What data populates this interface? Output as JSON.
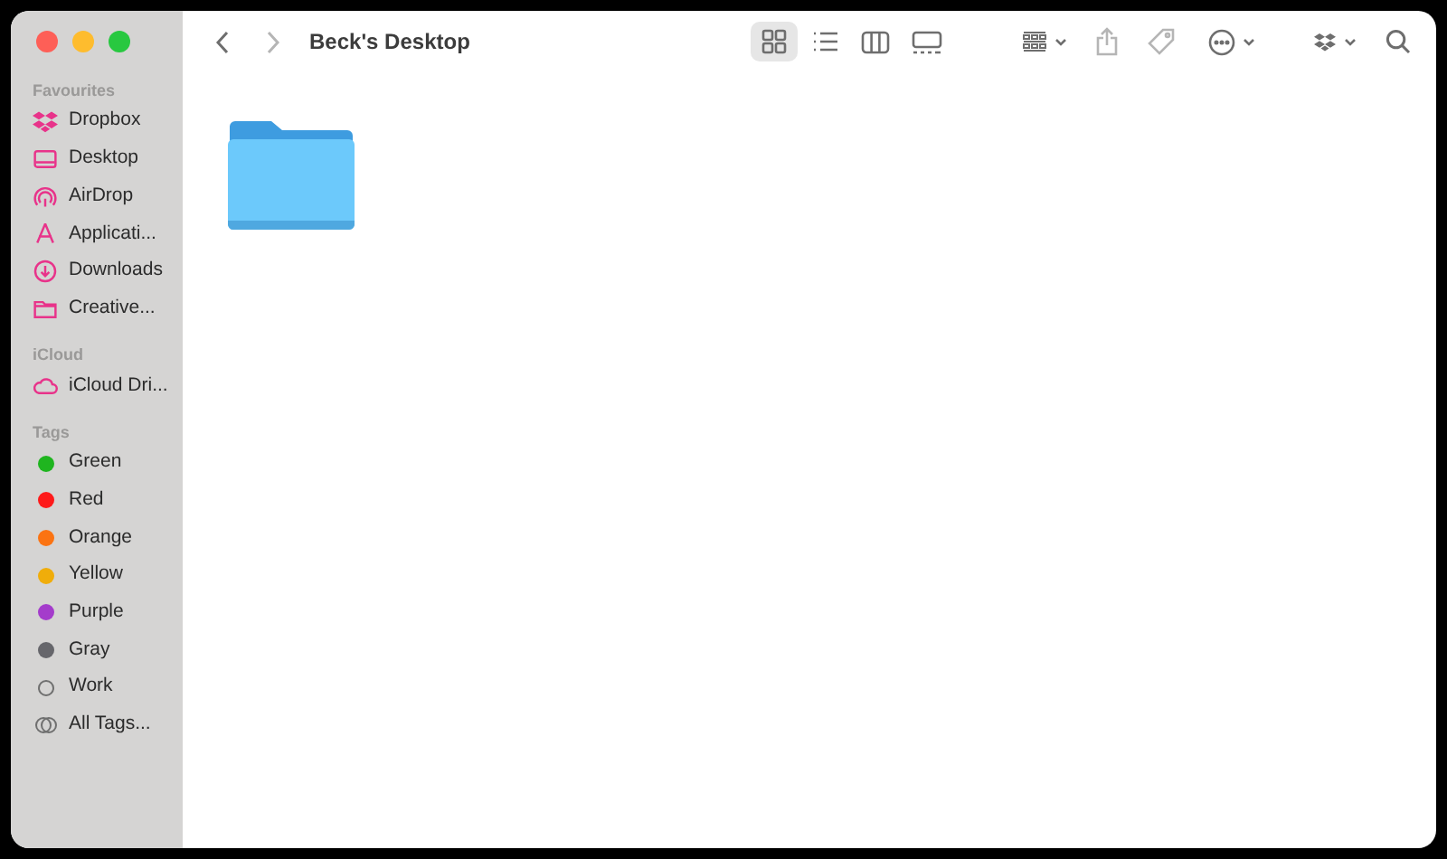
{
  "window": {
    "title": "Beck's Desktop"
  },
  "sidebar": {
    "sections": [
      {
        "heading": "Favourites",
        "items": [
          {
            "label": "Dropbox",
            "kind": "dropbox"
          },
          {
            "label": "Desktop",
            "kind": "desktop"
          },
          {
            "label": "AirDrop",
            "kind": "airdrop"
          },
          {
            "label": "Applicati...",
            "kind": "apps"
          },
          {
            "label": "Downloads",
            "kind": "downloads"
          },
          {
            "label": "Creative...",
            "kind": "folder"
          }
        ]
      },
      {
        "heading": "iCloud",
        "items": [
          {
            "label": "iCloud Dri...",
            "kind": "cloud"
          }
        ]
      },
      {
        "heading": "Tags",
        "items": [
          {
            "label": "Green",
            "kind": "dot",
            "color": "#1fb51f"
          },
          {
            "label": "Red",
            "kind": "dot",
            "color": "#fe1a1a"
          },
          {
            "label": "Orange",
            "kind": "dot",
            "color": "#fb7312"
          },
          {
            "label": "Yellow",
            "kind": "dot",
            "color": "#f0ad0a"
          },
          {
            "label": "Purple",
            "kind": "dot",
            "color": "#a43ccb"
          },
          {
            "label": "Gray",
            "kind": "dot",
            "color": "#66666b"
          },
          {
            "label": "Work",
            "kind": "ring"
          },
          {
            "label": "All Tags...",
            "kind": "alltags"
          }
        ]
      }
    ]
  },
  "toolbar": {
    "views": [
      {
        "kind": "icons",
        "selected": true
      },
      {
        "kind": "list",
        "selected": false
      },
      {
        "kind": "columns",
        "selected": false
      },
      {
        "kind": "gallery",
        "selected": false
      }
    ]
  },
  "files": [
    {
      "kind": "folder"
    }
  ]
}
